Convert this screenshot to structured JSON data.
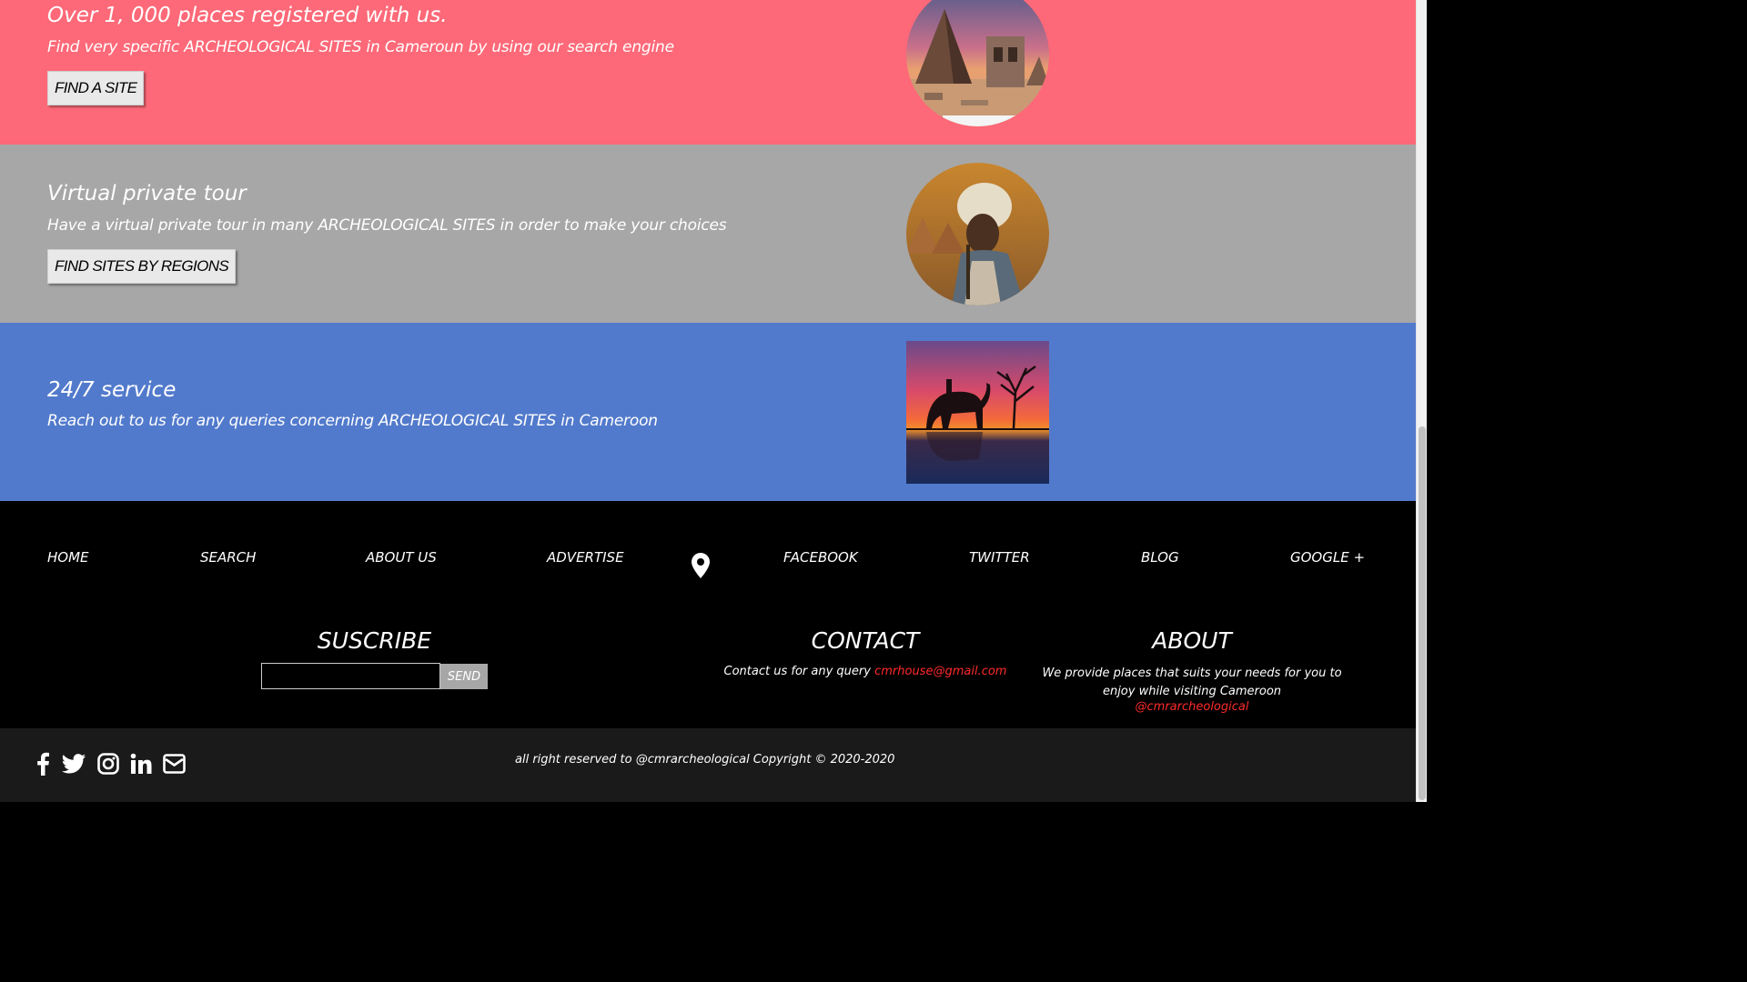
{
  "feature1": {
    "title": "Over 1, 000 places registered with us.",
    "description": "Find very specific ARCHEOLOGICAL SITES in Cameroun by using our search engine",
    "button": "FIND A SITE"
  },
  "feature2": {
    "title": "Virtual private tour",
    "description": "Have a virtual private tour in many ARCHEOLOGICAL SITES in order to make your choices",
    "button": "FIND SITES BY REGIONS"
  },
  "feature3": {
    "title": "24/7 service",
    "description": "Reach out to us for any queries concerning ARCHEOLOGICAL SITES in Cameroon"
  },
  "nav": {
    "home": "HOME",
    "search": "SEARCH",
    "about_us": "ABOUT US",
    "advertise": "ADVERTISE",
    "facebook": "FACEBOOK",
    "twitter": "TWITTER",
    "blog": "BLOG",
    "google": "GOOGLE +"
  },
  "subscribe": {
    "title": "SUSCRIBE",
    "input_value": "",
    "send": "SEND"
  },
  "contact": {
    "title": "CONTACT",
    "text": "Contact us for any query",
    "email": "cmrhouse@gmail.com"
  },
  "about": {
    "title": "ABOUT",
    "text": "We provide places that suits your needs for you to enjoy while visiting Cameroon",
    "handle": "@cmrarcheological"
  },
  "copyright": "all right reserved to @cmrarcheological Copyright © 2020-2020",
  "social_icons": [
    "facebook-icon",
    "twitter-icon",
    "instagram-icon",
    "linkedin-icon",
    "email-icon"
  ],
  "colors": {
    "band_red": "#fd6978",
    "band_gray": "#a7a7a7",
    "band_blue": "#527acc",
    "link_red": "#ff2a2a"
  }
}
